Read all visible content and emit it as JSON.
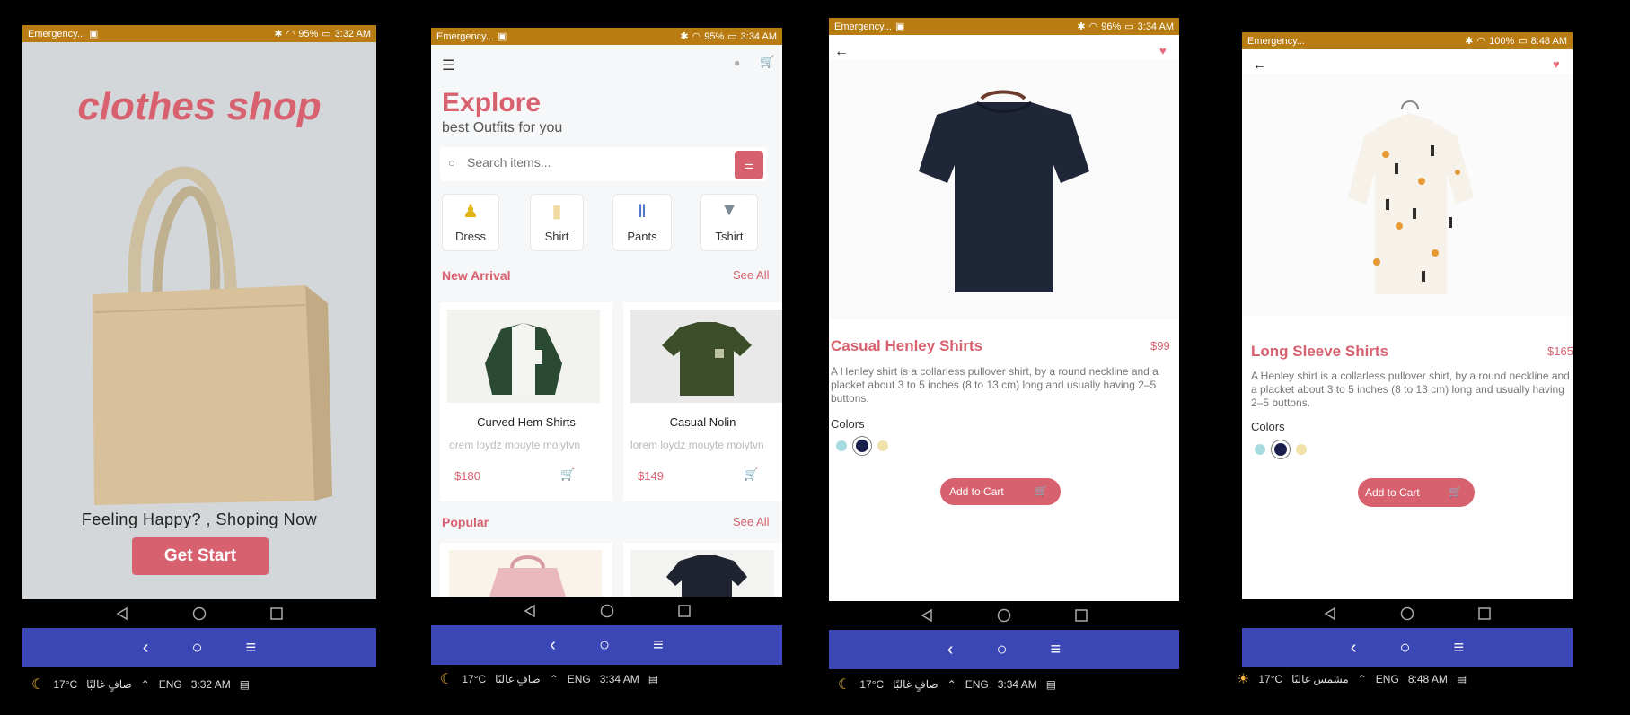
{
  "status": {
    "carrier": "Emergency...",
    "carrier3": "Emergency...",
    "screen1": {
      "battery": "95%",
      "time": "3:32 AM"
    },
    "screen2": {
      "battery": "95%",
      "time": "3:34 AM"
    },
    "screen3": {
      "battery": "96%",
      "time": "3:34 AM"
    },
    "screen4": {
      "battery": "100%",
      "time": "8:48 AM"
    }
  },
  "splash": {
    "title": "clothes shop",
    "tagline": "Feeling Happy? , Shoping Now",
    "cta": "Get Start"
  },
  "explore": {
    "title": "Explore",
    "subtitle": "best Outfits for you",
    "search_placeholder": "Search items...",
    "categories": [
      {
        "label": "Dress",
        "icon": "dress-icon"
      },
      {
        "label": "Shirt",
        "icon": "shirt-icon"
      },
      {
        "label": "Pants",
        "icon": "pants-icon"
      },
      {
        "label": "Tshirt",
        "icon": "tshirt-icon"
      }
    ],
    "new_arrival": "New Arrival",
    "see_all": "See All",
    "popular": "Popular",
    "products": [
      {
        "name": "Curved Hem Shirts",
        "desc": "orem loydz mouyte moiytvn",
        "price": "$180"
      },
      {
        "name": "Casual Nolin",
        "desc": "lorem loydz mouyte moiytvn",
        "price": "$149"
      }
    ]
  },
  "detail1": {
    "name": "Casual Henley Shirts",
    "price": "$99",
    "desc": "A Henley shirt is a collarless pullover shirt, by a round neckline and a placket about 3 to 5 inches (8 to 13 cm) long and usually having 2–5 buttons.",
    "colors_label": "Colors",
    "add_to_cart": "Add to Cart",
    "swatches": [
      "#a6dbe0",
      "#1b1f4d",
      "#f1e2ab"
    ]
  },
  "detail2": {
    "name": "Long Sleeve Shirts",
    "price": "$165",
    "desc": "A Henley shirt is a collarless pullover shirt, by a round neckline and a placket about 3 to 5 inches (8 to 13 cm) long and usually having 2–5 buttons.",
    "colors_label": "Colors",
    "add_to_cart": "Add to Cart",
    "swatches": [
      "#a6dbe0",
      "#1b1f4d",
      "#f1e2ab"
    ]
  },
  "taskbar": {
    "temp": "17°C",
    "weather1": "صافٍ غالبًا",
    "weather4": "مشمس غالبًا",
    "lang": "ENG",
    "time1": "3:32 AM",
    "time2": "3:34 AM",
    "time3": "3:34 AM",
    "time4": "8:48 AM"
  },
  "colors": {
    "accent": "#d8616f",
    "statusbar": "#b87c12",
    "navblue": "#3b47b5"
  }
}
